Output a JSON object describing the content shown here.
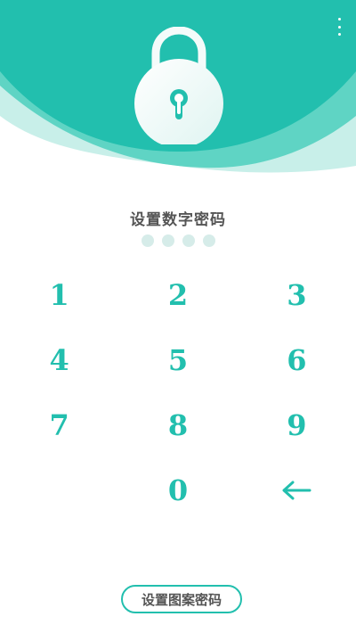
{
  "colors": {
    "accent": "#22bfae",
    "header_light": "#c8efe9",
    "header_mid": "#5fd4c4",
    "dot_empty": "#d6ece9",
    "text": "#555555"
  },
  "header": {
    "menu_icon": "more-vertical-icon",
    "lock_icon": "padlock-icon"
  },
  "pin": {
    "title": "设置数字密码",
    "length": 4,
    "entered": 0
  },
  "keypad": {
    "keys": [
      "1",
      "2",
      "3",
      "4",
      "5",
      "6",
      "7",
      "8",
      "9",
      "",
      "0",
      "←"
    ],
    "backspace_icon": "backspace-arrow-icon"
  },
  "footer": {
    "pattern_button_label": "设置图案密码"
  }
}
